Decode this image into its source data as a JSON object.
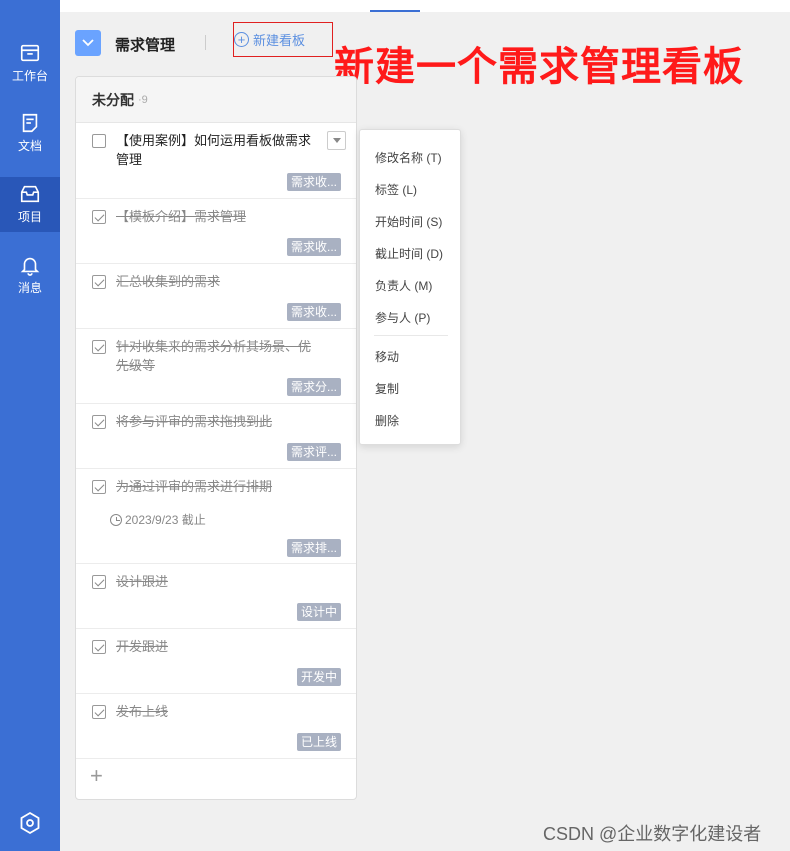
{
  "sidebar": {
    "items": [
      {
        "label": "工作台",
        "icon": "inbox-tray-icon"
      },
      {
        "label": "文档",
        "icon": "document-icon"
      },
      {
        "label": "项目",
        "icon": "project-box-icon"
      },
      {
        "label": "消息",
        "icon": "bell-icon"
      }
    ],
    "active": "项目",
    "bottom_icon": "settings-hexagon-icon",
    "color": "#3b6fd4"
  },
  "header": {
    "project_title": "需求管理",
    "new_board_label": "新建看板",
    "annotation": "新建一个需求管理看板",
    "annotation_color": "#ff1a1a"
  },
  "column": {
    "title": "未分配",
    "count": "·9",
    "tasks": [
      {
        "text": "【使用案例】如何运用看板做需求管理",
        "done": false,
        "tag": "需求收..."
      },
      {
        "text": "【模板介绍】需求管理",
        "done": true,
        "tag": "需求收..."
      },
      {
        "text": "汇总收集到的需求",
        "done": true,
        "tag": "需求收..."
      },
      {
        "text": "针对收集来的需求分析其场景、优先级等",
        "done": true,
        "tag": "需求分..."
      },
      {
        "text": "将参与评审的需求拖拽到此",
        "done": true,
        "tag": "需求评..."
      },
      {
        "text": "为通过评审的需求进行排期",
        "done": true,
        "tag": "需求排...",
        "due": "2023/9/23 截止"
      },
      {
        "text": "设计跟进",
        "done": true,
        "tag": "设计中"
      },
      {
        "text": "开发跟进",
        "done": true,
        "tag": "开发中"
      },
      {
        "text": "发布上线",
        "done": true,
        "tag": "已上线"
      }
    ],
    "add_label": "+"
  },
  "context_menu": {
    "items": [
      "修改名称 (T)",
      "标签 (L)",
      "开始时间 (S)",
      "截止时间 (D)",
      "负责人 (M)",
      "参与人 (P)",
      "移动",
      "复制",
      "删除"
    ]
  },
  "watermark": "CSDN @企业数字化建设者"
}
